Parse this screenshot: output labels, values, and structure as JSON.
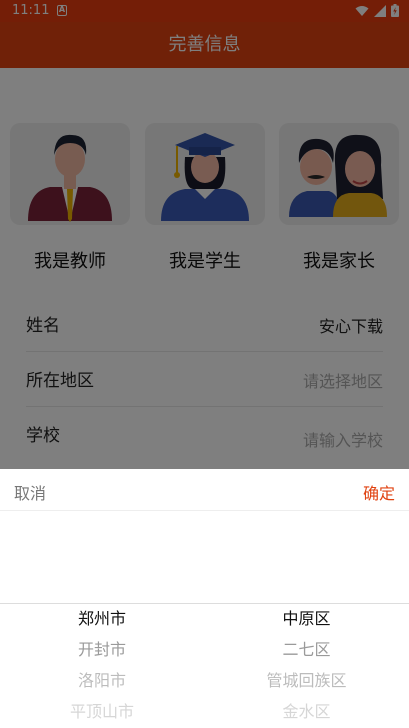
{
  "status_bar": {
    "time": "11:11",
    "sim_glyph": "A",
    "icons": [
      "wifi-icon",
      "signal-icon",
      "battery-charging-icon"
    ]
  },
  "app_bar": {
    "title": "完善信息"
  },
  "roles": [
    {
      "label": "我是教师",
      "icon": "teacher-avatar"
    },
    {
      "label": "我是学生",
      "icon": "graduate-student-avatar"
    },
    {
      "label": "我是家长",
      "icon": "parents-avatar"
    }
  ],
  "form": {
    "name": {
      "label": "姓名",
      "value": "安心下载"
    },
    "region": {
      "label": "所在地区",
      "placeholder": "请选择地区"
    },
    "school": {
      "label": "学校",
      "placeholder": "请输入学校"
    }
  },
  "picker": {
    "cancel_label": "取消",
    "confirm_label": "确定",
    "cities": [
      "郑州市",
      "开封市",
      "洛阳市",
      "平顶山市"
    ],
    "districts": [
      "中原区",
      "二七区",
      "管城回族区",
      "金水区"
    ],
    "accent_color": "#e04210"
  }
}
